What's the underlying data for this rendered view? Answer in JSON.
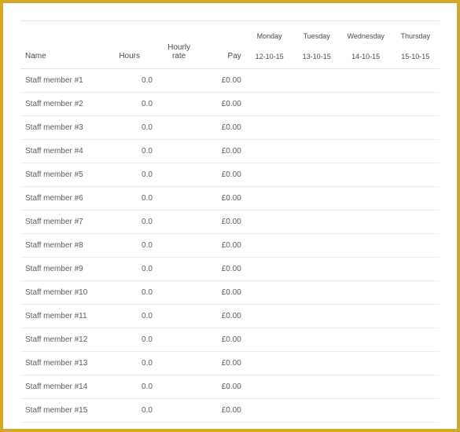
{
  "headers": {
    "name": "Name",
    "hours": "Hours",
    "hourly_rate": "Hourly rate",
    "pay": "Pay",
    "days": [
      {
        "label": "Monday",
        "date": "12-10-15"
      },
      {
        "label": "Tuesday",
        "date": "13-10-15"
      },
      {
        "label": "Wednesday",
        "date": "14-10-15"
      },
      {
        "label": "Thursday",
        "date": "15-10-15"
      }
    ]
  },
  "rows": [
    {
      "name": "Staff member #1",
      "hours": "0.0",
      "rate": "",
      "pay": "£0.00",
      "d0": "",
      "d1": "",
      "d2": "",
      "d3": ""
    },
    {
      "name": "Staff member #2",
      "hours": "0.0",
      "rate": "",
      "pay": "£0.00",
      "d0": "",
      "d1": "",
      "d2": "",
      "d3": ""
    },
    {
      "name": "Staff member #3",
      "hours": "0.0",
      "rate": "",
      "pay": "£0.00",
      "d0": "",
      "d1": "",
      "d2": "",
      "d3": ""
    },
    {
      "name": "Staff member #4",
      "hours": "0.0",
      "rate": "",
      "pay": "£0.00",
      "d0": "",
      "d1": "",
      "d2": "",
      "d3": ""
    },
    {
      "name": "Staff member #5",
      "hours": "0.0",
      "rate": "",
      "pay": "£0.00",
      "d0": "",
      "d1": "",
      "d2": "",
      "d3": ""
    },
    {
      "name": "Staff member #6",
      "hours": "0.0",
      "rate": "",
      "pay": "£0.00",
      "d0": "",
      "d1": "",
      "d2": "",
      "d3": ""
    },
    {
      "name": "Staff member #7",
      "hours": "0.0",
      "rate": "",
      "pay": "£0.00",
      "d0": "",
      "d1": "",
      "d2": "",
      "d3": ""
    },
    {
      "name": "Staff member #8",
      "hours": "0.0",
      "rate": "",
      "pay": "£0.00",
      "d0": "",
      "d1": "",
      "d2": "",
      "d3": ""
    },
    {
      "name": "Staff member #9",
      "hours": "0.0",
      "rate": "",
      "pay": "£0.00",
      "d0": "",
      "d1": "",
      "d2": "",
      "d3": ""
    },
    {
      "name": "Staff member #10",
      "hours": "0.0",
      "rate": "",
      "pay": "£0.00",
      "d0": "",
      "d1": "",
      "d2": "",
      "d3": ""
    },
    {
      "name": "Staff member #11",
      "hours": "0.0",
      "rate": "",
      "pay": "£0.00",
      "d0": "",
      "d1": "",
      "d2": "",
      "d3": ""
    },
    {
      "name": "Staff member #12",
      "hours": "0.0",
      "rate": "",
      "pay": "£0.00",
      "d0": "",
      "d1": "",
      "d2": "",
      "d3": ""
    },
    {
      "name": "Staff member #13",
      "hours": "0.0",
      "rate": "",
      "pay": "£0.00",
      "d0": "",
      "d1": "",
      "d2": "",
      "d3": ""
    },
    {
      "name": "Staff member #14",
      "hours": "0.0",
      "rate": "",
      "pay": "£0.00",
      "d0": "",
      "d1": "",
      "d2": "",
      "d3": ""
    },
    {
      "name": "Staff member #15",
      "hours": "0.0",
      "rate": "",
      "pay": "£0.00",
      "d0": "",
      "d1": "",
      "d2": "",
      "d3": ""
    }
  ]
}
